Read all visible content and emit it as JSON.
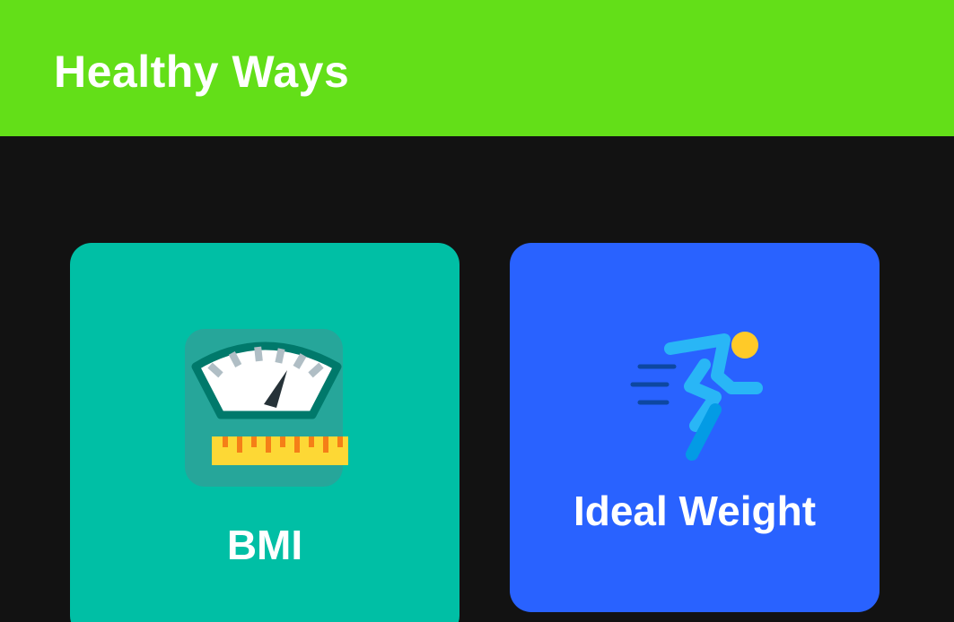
{
  "app": {
    "title": "Healthy Ways",
    "colors": {
      "appbar": "#63df18",
      "background": "#121212",
      "bmi_card": "#00bfa5",
      "ideal_card": "#2962ff"
    }
  },
  "cards": [
    {
      "label": "BMI",
      "icon": "weighing-scale-icon"
    },
    {
      "label": "Ideal Weight",
      "icon": "running-person-icon"
    }
  ]
}
